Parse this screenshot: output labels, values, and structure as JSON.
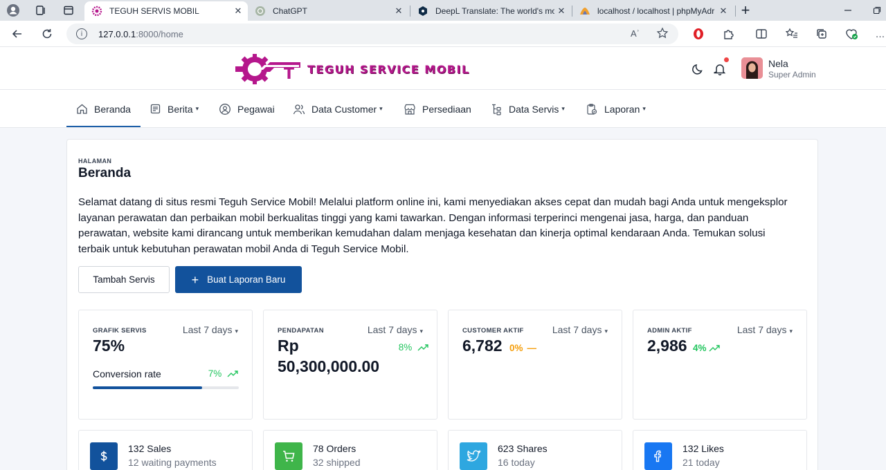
{
  "browser": {
    "tabs": [
      {
        "title": "TEGUH SERVIS MOBIL",
        "active": true
      },
      {
        "title": "ChatGPT",
        "active": false
      },
      {
        "title": "DeepL Translate: The world's mo",
        "active": false
      },
      {
        "title": "localhost / localhost | phpMyAdr",
        "active": false
      }
    ],
    "tab_close": "✕",
    "new_tab": "+",
    "url_host": "127.0.0.1",
    "url_rest": ":8000/home",
    "read_aloud": "Aʾ"
  },
  "header": {
    "brand": "TEGUH SERVICE MOBIL",
    "user_name": "Nela",
    "user_role": "Super Admin"
  },
  "nav": {
    "items": [
      {
        "label": "Beranda",
        "dropdown": false,
        "active": true
      },
      {
        "label": "Berita",
        "dropdown": true
      },
      {
        "label": "Pegawai",
        "dropdown": false
      },
      {
        "label": "Data Customer",
        "dropdown": true
      },
      {
        "label": "Persediaan",
        "dropdown": false
      },
      {
        "label": "Data Servis",
        "dropdown": true
      },
      {
        "label": "Laporan",
        "dropdown": true
      }
    ]
  },
  "page": {
    "breadcrumb": "HALAMAN",
    "title": "Beranda",
    "intro": "Selamat datang di situs resmi Teguh Service Mobil! Melalui platform online ini, kami menyediakan akses cepat dan mudah bagi Anda untuk mengeksplor layanan perawatan dan perbaikan mobil berkualitas tinggi yang kami tawarkan. Dengan informasi terperinci mengenai jasa, harga, dan panduan perawatan, website kami dirancang untuk memberikan kemudahan dalam menjaga kesehatan dan kinerja optimal kendaraan Anda. Temukan solusi terbaik untuk kebutuhan perawatan mobil Anda di Teguh Service Mobil.",
    "btn_secondary": "Tambah Servis",
    "btn_primary": "Buat Laporan Baru"
  },
  "stats": [
    {
      "label": "GRAFIK SERVIS",
      "period": "Last 7 days",
      "value": "75%",
      "sub_label": "Conversion rate",
      "sub_delta": "7%",
      "progress": 0.75
    },
    {
      "label": "PENDAPATAN",
      "period": "Last 7 days",
      "value_line1": "Rp",
      "value_line2": "50,300,000.00",
      "delta": "8%"
    },
    {
      "label": "CUSTOMER AKTIF",
      "period": "Last 7 days",
      "value": "6,782",
      "delta": "0%"
    },
    {
      "label": "ADMIN AKTIF",
      "period": "Last 7 days",
      "value": "2,986",
      "delta": "4%"
    }
  ],
  "mini_cards": [
    {
      "title": "132 Sales",
      "sub": "12 waiting payments",
      "icon": "dollar-icon",
      "color": "#12529c"
    },
    {
      "title": "78 Orders",
      "sub": "32 shipped",
      "icon": "cart-icon",
      "color": "#3fb54a"
    },
    {
      "title": "623 Shares",
      "sub": "16 today",
      "icon": "twitter-icon",
      "color": "#2ea7e0"
    },
    {
      "title": "132 Likes",
      "sub": "21 today",
      "icon": "facebook-icon",
      "color": "#1877f2"
    }
  ],
  "colors": {
    "accent": "#12529c",
    "brand": "#b5178c",
    "positive": "#22c55e",
    "neutral": "#f59e0b"
  }
}
